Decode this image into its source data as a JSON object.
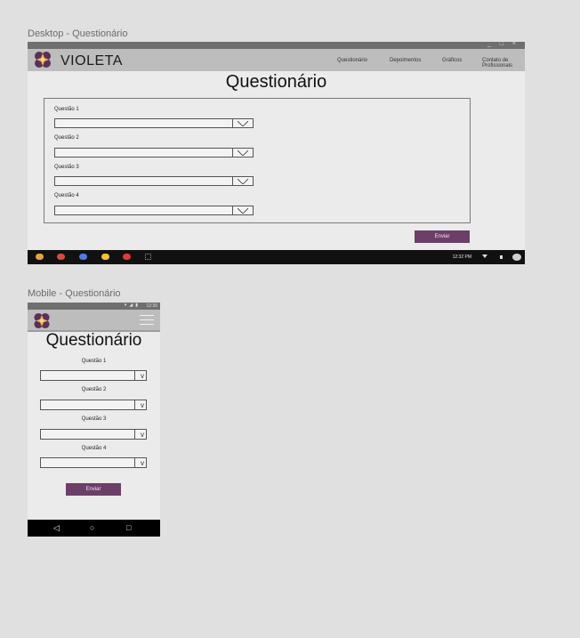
{
  "desktop": {
    "frame_label": "Desktop - Questionário",
    "window_controls": "_ □ ×",
    "brand": "VIOLETA",
    "nav": [
      "Questionário",
      "Depoimentos",
      "Gráficos",
      "Contato de Profissionais"
    ],
    "title": "Questionário",
    "questions": [
      {
        "label": "Questão 1"
      },
      {
        "label": "Questão 2"
      },
      {
        "label": "Questão 3"
      },
      {
        "label": "Questão 4"
      }
    ],
    "submit_label": "Enviar",
    "taskbar_time": "12:32 PM",
    "taskbar_icons": [
      {
        "icon": "chrome-icon",
        "color": "#e8a23a"
      },
      {
        "icon": "gmail-icon",
        "color": "#d84b3e"
      },
      {
        "icon": "google-icon",
        "color": "#4a7be8"
      },
      {
        "icon": "drive-icon",
        "color": "#f2c230"
      },
      {
        "icon": "youtube-icon",
        "color": "#e53935"
      },
      {
        "icon": "apps-grid-icon",
        "color": "#9e9e9e"
      }
    ]
  },
  "mobile": {
    "frame_label": "Mobile - Questionário",
    "status_time": "12:30",
    "title": "Questionário",
    "questions": [
      {
        "label": "Questão 1"
      },
      {
        "label": "Questão 2"
      },
      {
        "label": "Questão 3"
      },
      {
        "label": "Questão 4"
      }
    ],
    "submit_label": "Enviar",
    "nav_buttons": [
      "◁",
      "○",
      "□"
    ]
  },
  "colors": {
    "accent": "#6b3f68",
    "header": "#bdbdbd",
    "bar": "#6f6f6f",
    "logo_outer": "#5c2f5a",
    "logo_inner": "#e6b84a"
  }
}
